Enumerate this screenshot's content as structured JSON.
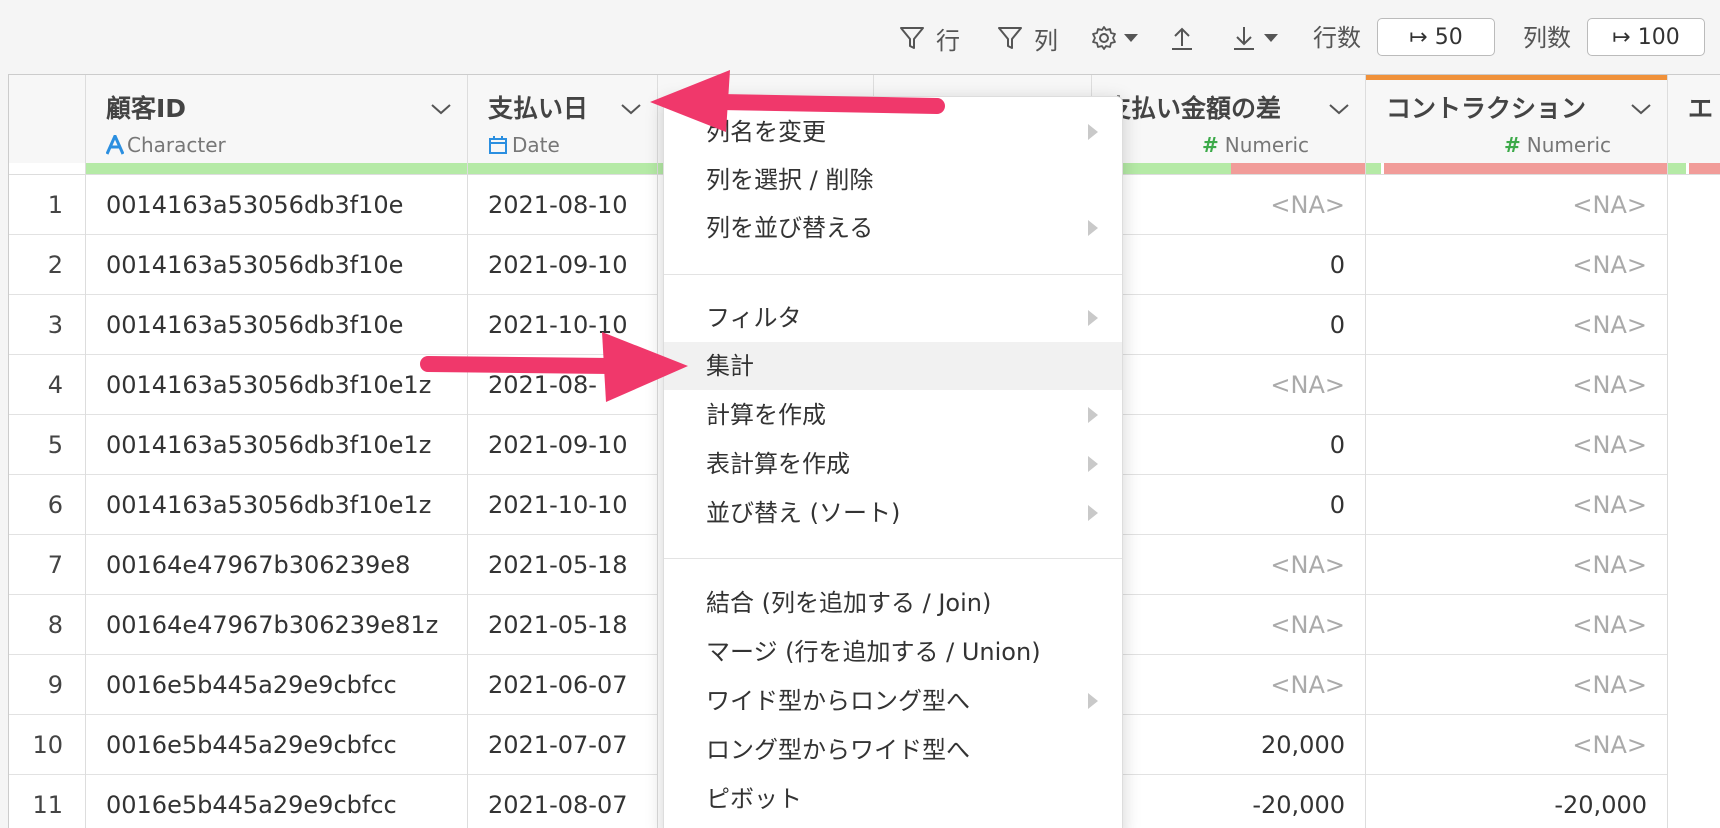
{
  "toolbar": {
    "row_filter_label": "行",
    "col_filter_label": "列",
    "row_count_label": "行数",
    "row_count_value": "↦ 50",
    "col_count_label": "列数",
    "col_count_value": "↦ 100"
  },
  "columns": [
    {
      "name": "顧客ID",
      "type": "Character"
    },
    {
      "name": "支払い日",
      "type": "Date"
    },
    {
      "name": "支払い金額の差",
      "type": "Numeric"
    },
    {
      "name": "コントラクション",
      "type": "Numeric"
    },
    {
      "name": "エ"
    }
  ],
  "rows": [
    {
      "n": "1",
      "id": "0014163a53056db3f10e",
      "date": "2021-08-10",
      "diff": "<NA>",
      "contr": "<NA>"
    },
    {
      "n": "2",
      "id": "0014163a53056db3f10e",
      "date": "2021-09-10",
      "diff": "0",
      "contr": "<NA>"
    },
    {
      "n": "3",
      "id": "0014163a53056db3f10e",
      "date": "2021-10-10",
      "diff": "0",
      "contr": "<NA>"
    },
    {
      "n": "4",
      "id": "0014163a53056db3f10e1z",
      "date": "2021-08-",
      "diff": "<NA>",
      "contr": "<NA>"
    },
    {
      "n": "5",
      "id": "0014163a53056db3f10e1z",
      "date": "2021-09-10",
      "diff": "0",
      "contr": "<NA>"
    },
    {
      "n": "6",
      "id": "0014163a53056db3f10e1z",
      "date": "2021-10-10",
      "diff": "0",
      "contr": "<NA>"
    },
    {
      "n": "7",
      "id": "00164e47967b306239e8",
      "date": "2021-05-18",
      "diff": "<NA>",
      "contr": "<NA>"
    },
    {
      "n": "8",
      "id": "00164e47967b306239e81z",
      "date": "2021-05-18",
      "diff": "<NA>",
      "contr": "<NA>"
    },
    {
      "n": "9",
      "id": "0016e5b445a29e9cbfcc",
      "date": "2021-06-07",
      "diff": "<NA>",
      "contr": "<NA>"
    },
    {
      "n": "10",
      "id": "0016e5b445a29e9cbfcc",
      "date": "2021-07-07",
      "diff": "20,000",
      "contr": "<NA>"
    },
    {
      "n": "11",
      "id": "0016e5b445a29e9cbfcc",
      "date": "2021-08-07",
      "diff": "-20,000",
      "contr": "-20,000"
    }
  ],
  "menu": {
    "items": [
      {
        "label": "列名を変更"
      },
      {
        "label": "列を選択 / 削除"
      },
      {
        "label": "列を並び替える"
      },
      {
        "label": "フィルタ"
      },
      {
        "label": "集計"
      },
      {
        "label": "計算を作成"
      },
      {
        "label": "表計算を作成"
      },
      {
        "label": "並び替え (ソート)"
      },
      {
        "label": "結合 (列を追加する / Join)"
      },
      {
        "label": "マージ (行を追加する / Union)"
      },
      {
        "label": "ワイド型からロング型へ"
      },
      {
        "label": "ロング型からワイド型へ"
      },
      {
        "label": "ピボット"
      }
    ],
    "highlighted": "集計"
  },
  "colors": {
    "accent_orange": "#f0913a",
    "quality_green": "#b5eaa6",
    "quality_red": "#f19c99",
    "arrow_pink": "#f0386b",
    "type_blue": "#2b8fe0",
    "type_green": "#3daa4a"
  }
}
